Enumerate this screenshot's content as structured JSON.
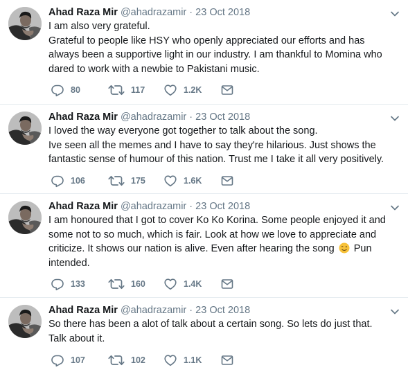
{
  "colors": {
    "text": "#14171a",
    "muted": "#657786",
    "divider": "#e6ecf0",
    "emoji": "#f7c23a"
  },
  "icons": {
    "reply": "reply-icon",
    "retweet": "retweet-icon",
    "like": "heart-icon",
    "message": "envelope-icon",
    "more": "chevron-down-icon",
    "emoji": "winking-face-emoji"
  },
  "tweets": [
    {
      "author": {
        "name": "Ahad Raza Mir",
        "handle": "@ahadrazamir"
      },
      "separator": "·",
      "date": "23 Oct 2018",
      "lines": [
        "I am also very grateful.",
        "Grateful to people like HSY who openly appreciated our efforts and has always been a supportive light in our industry. I am thankful to Momina who dared to work with a newbie to Pakistani music."
      ],
      "replies": "80",
      "retweets": "117",
      "likes": "1.2K"
    },
    {
      "author": {
        "name": "Ahad Raza Mir",
        "handle": "@ahadrazamir"
      },
      "separator": "·",
      "date": "23 Oct 2018",
      "lines": [
        "I loved the way everyone got together to talk about the song.",
        "Ive seen all the memes and I have to say they're hilarious. Just shows the fantastic sense of humour of this nation. Trust me I take it all very positively."
      ],
      "replies": "106",
      "retweets": "175",
      "likes": "1.6K"
    },
    {
      "author": {
        "name": "Ahad Raza Mir",
        "handle": "@ahadrazamir"
      },
      "separator": "·",
      "date": "23 Oct 2018",
      "text_before_emoji": "I am honoured that I got to cover Ko Ko Korina. Some people enjoyed it and some not to so much, which is fair. Look at how we love to appreciate and criticize. It shows our nation is alive. Even after hearing the song",
      "text_after_emoji": "Pun intended.",
      "replies": "133",
      "retweets": "160",
      "likes": "1.4K"
    },
    {
      "author": {
        "name": "Ahad Raza Mir",
        "handle": "@ahadrazamir"
      },
      "separator": "·",
      "date": "23 Oct 2018",
      "lines": [
        "So there has been a alot of talk about a certain song. So lets do just that. Talk about it."
      ],
      "replies": "107",
      "retweets": "102",
      "likes": "1.1K"
    }
  ]
}
